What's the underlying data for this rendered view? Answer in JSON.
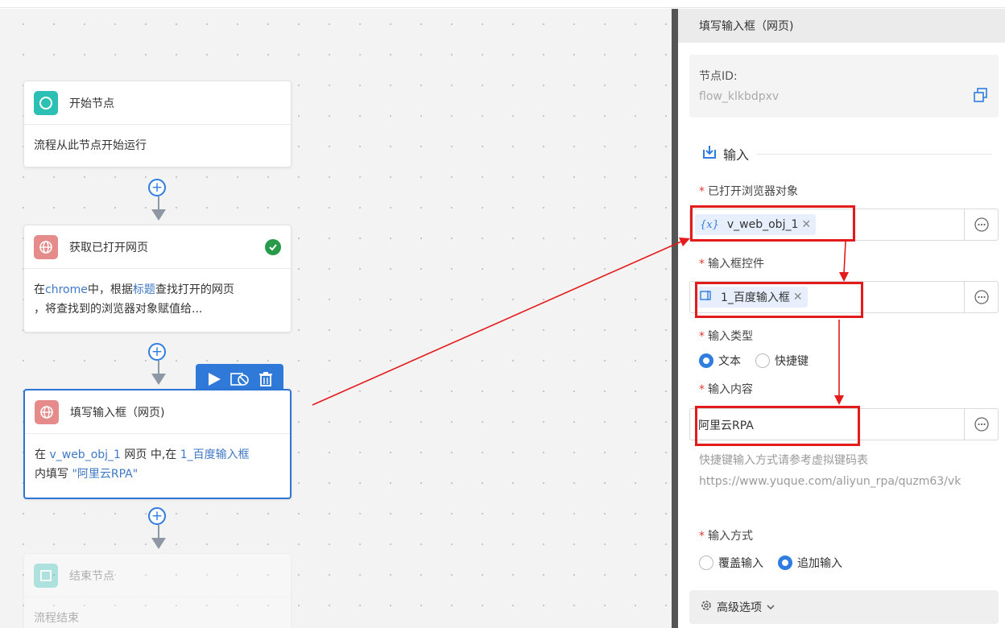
{
  "colors": {
    "accent": "#2f7de0",
    "annotation_red": "#e41b1b",
    "success": "#279b4a"
  },
  "flow": {
    "start_node": {
      "title": "开始节点",
      "desc": "流程从此节点开始运行",
      "icon": "circle-icon"
    },
    "get_page_node": {
      "title": "获取已打开网页",
      "desc_pre": "在",
      "desc_browser": "chrome",
      "desc_mid": "中，根据",
      "desc_key": "标题",
      "desc_post": "查找打开的网页",
      "desc_line2": "，将查找到的浏览器对象赋值给...",
      "icon": "globe-icon"
    },
    "fill_node": {
      "title": "填写输入框（网页)",
      "desc_pre": "在 ",
      "desc_var": "v_web_obj_1",
      "desc_mid1": " 网页 中,在 ",
      "desc_ctrl": "1_百度输入框",
      "desc_line2_pre": "内填写 ",
      "desc_value": "\"阿里云RPA\"",
      "icon": "globe-icon"
    },
    "end_node": {
      "title": "结束节点",
      "desc": "流程结束",
      "icon": "square-icon"
    },
    "toolbar": {
      "run": "run-icon",
      "disable": "disable-icon",
      "delete": "trash-icon"
    }
  },
  "panel": {
    "header_title": "填写输入框（网页)",
    "node_id_label": "节点ID:",
    "node_id_value": "flow_klkbdpxv",
    "section_title": "输入",
    "browser_obj": {
      "label": "已打开浏览器对象",
      "tag_icon": "{x}",
      "tag_value": "v_web_obj_1"
    },
    "input_ctrl": {
      "label": "输入框控件",
      "tag_icon": "⊏⃞",
      "tag_value": "1_百度输入框"
    },
    "input_type": {
      "label": "输入类型",
      "options": [
        "文本",
        "快捷键"
      ],
      "selected": "文本"
    },
    "input_content": {
      "label": "输入内容",
      "value": "阿里云RPA"
    },
    "hint_line1": "快捷键输入方式请参考虚拟键码表",
    "hint_url": "https://www.yuque.com/aliyun_rpa/quzm63/vk",
    "input_mode": {
      "label": "输入方式",
      "options": [
        "覆盖输入",
        "追加输入"
      ],
      "selected": "追加输入"
    },
    "advanced_label": "高级选项"
  }
}
